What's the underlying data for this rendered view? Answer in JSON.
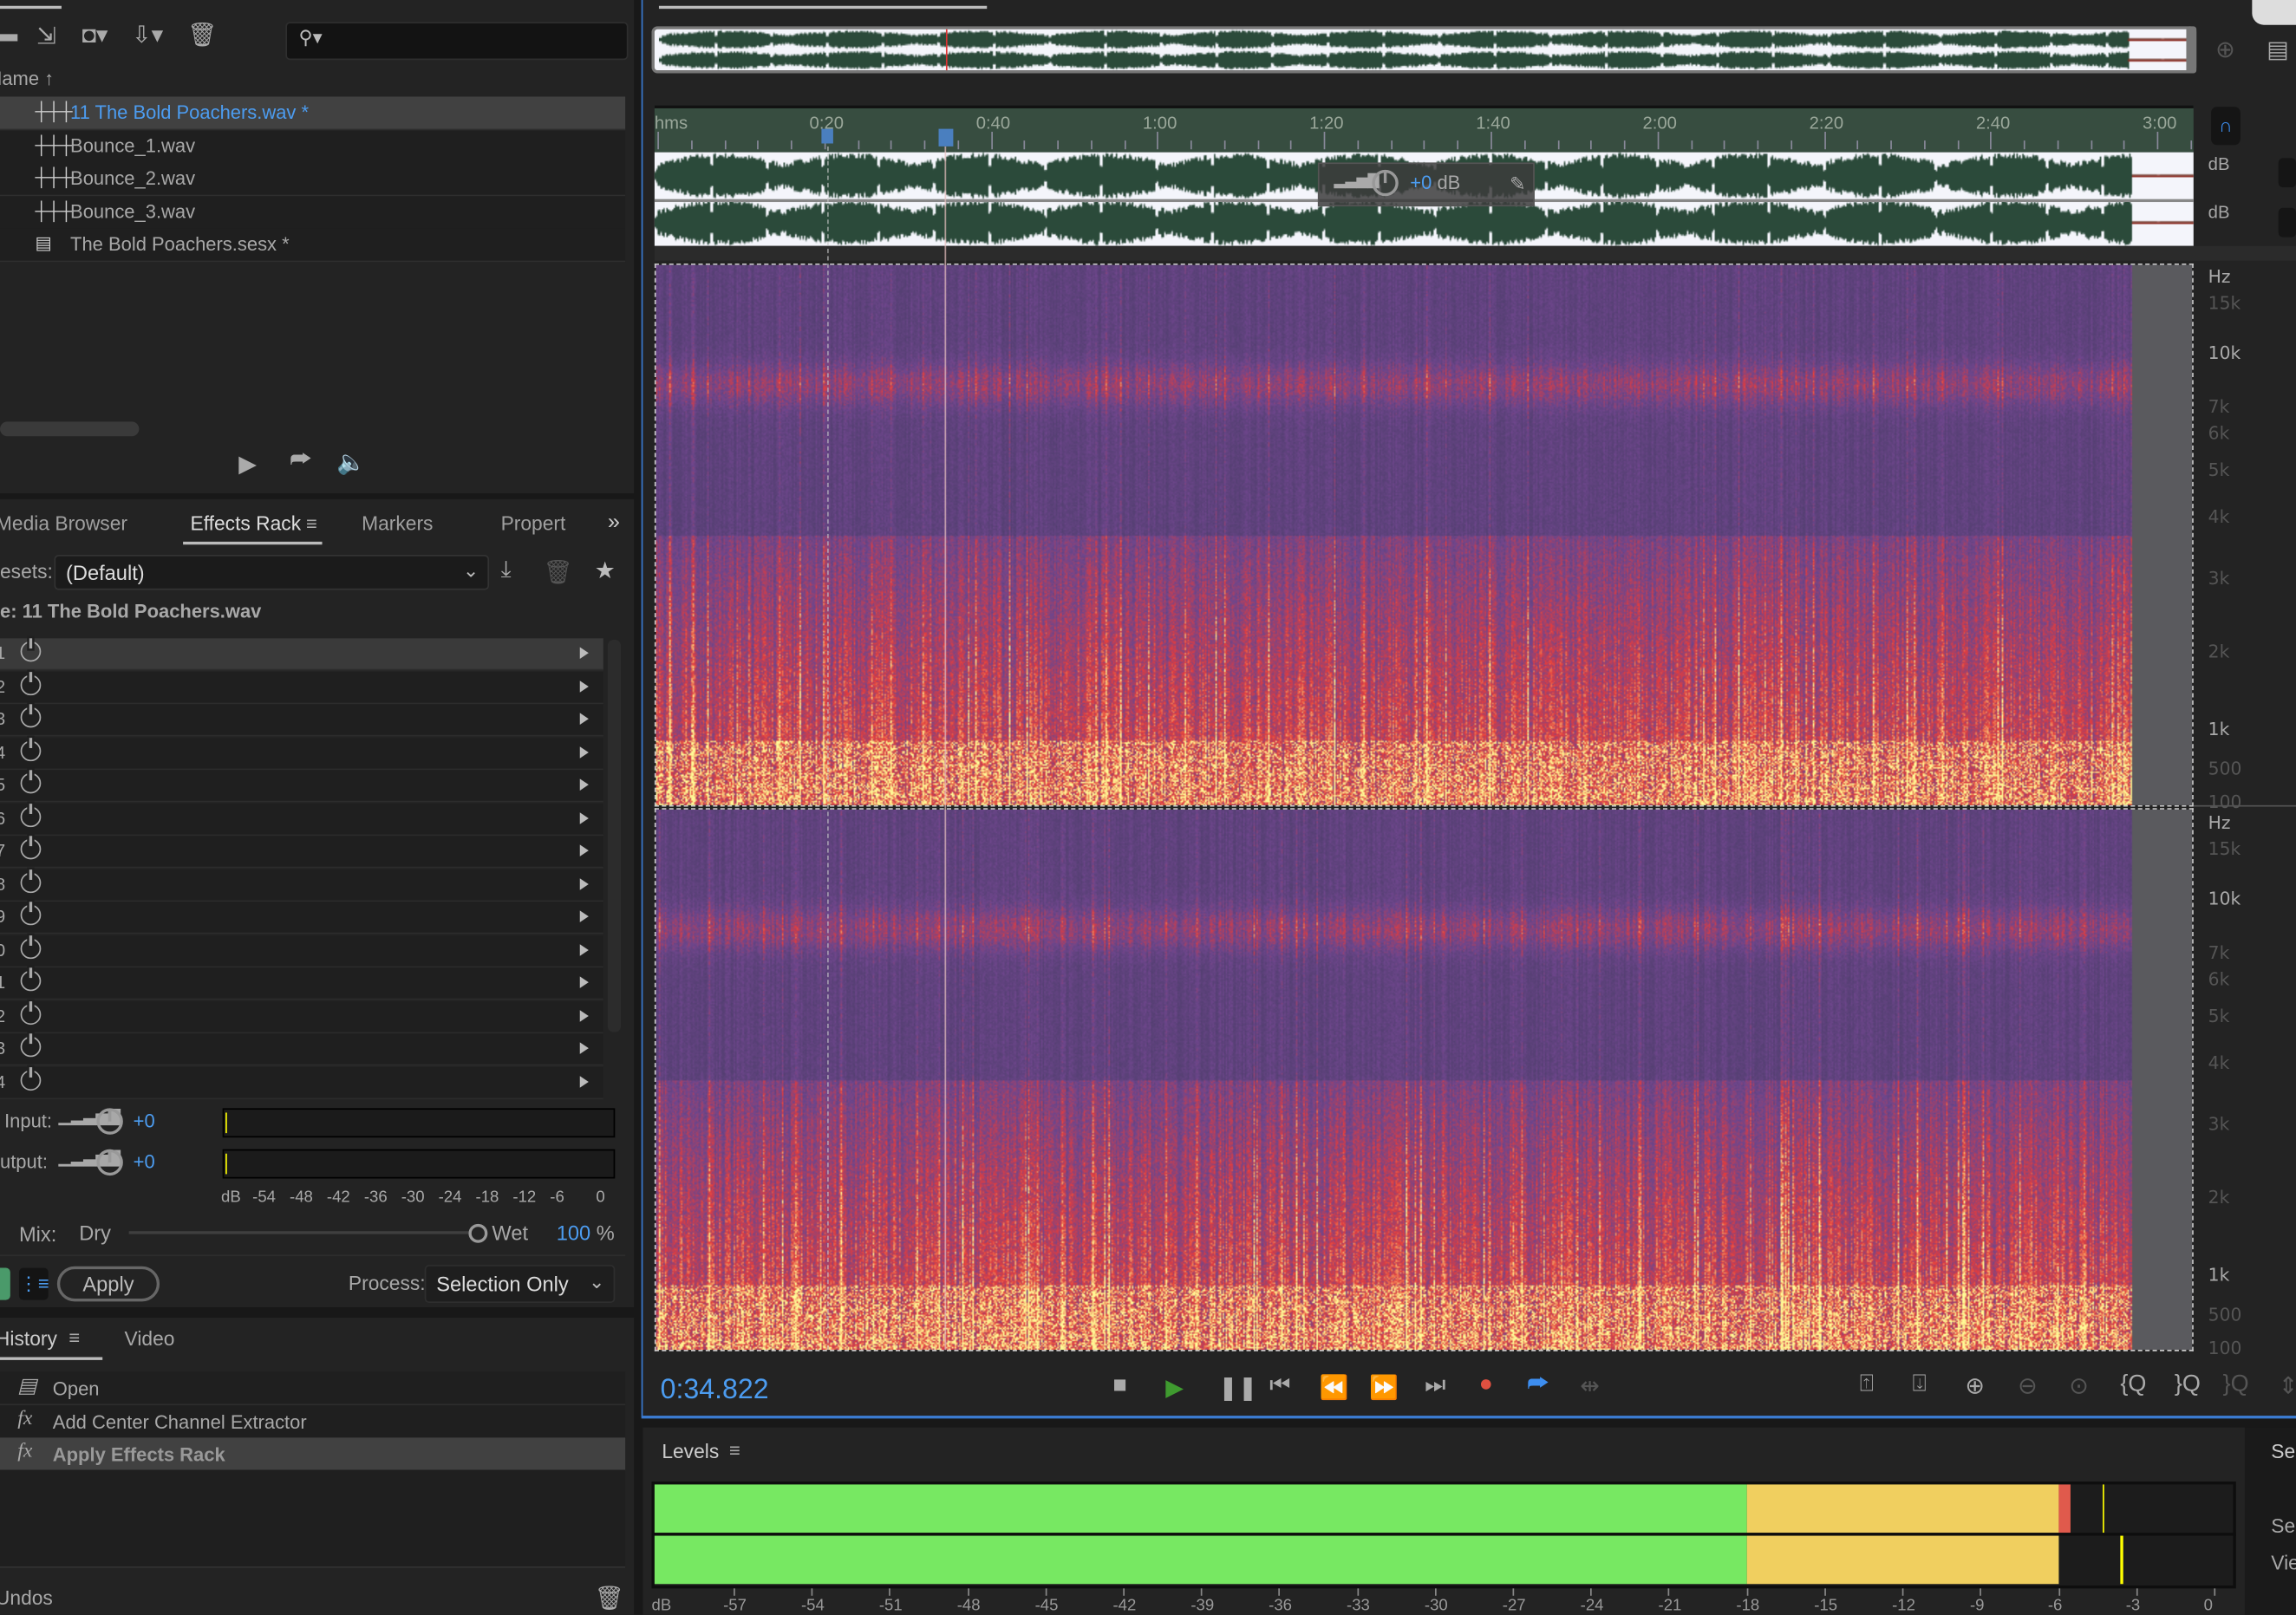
{
  "files": {
    "column_header": "Name",
    "sort_icon": "arrow-up-icon",
    "items": [
      {
        "name": "11 The Bold Poachers.wav *",
        "icon": "waveform-file-icon",
        "selected": true
      },
      {
        "name": "Bounce_1.wav",
        "icon": "waveform-file-icon"
      },
      {
        "name": "Bounce_2.wav",
        "icon": "waveform-file-icon"
      },
      {
        "name": "Bounce_3.wav",
        "icon": "waveform-file-icon"
      },
      {
        "name": "The Bold Poachers.sesx *",
        "icon": "multitrack-session-icon"
      }
    ],
    "search_placeholder": ""
  },
  "tabs": [
    {
      "label": "Media Browser"
    },
    {
      "label": "Effects Rack",
      "active": true
    },
    {
      "label": "Markers"
    },
    {
      "label": "Propert"
    }
  ],
  "effects_rack": {
    "presets_label": "esets:",
    "preset_value": "(Default)",
    "file_label": "e: 11 The Bold Poachers.wav",
    "slots": [
      "1",
      "2",
      "3",
      "4",
      "5",
      "6",
      "7",
      "8",
      "9",
      "0",
      "1",
      "2",
      "3",
      "4"
    ],
    "input_label": "Input:",
    "input_value": "+0",
    "output_label": "utput:",
    "output_value": "+0",
    "meter_scale": [
      "dB",
      "-54",
      "-48",
      "-42",
      "-36",
      "-30",
      "-24",
      "-18",
      "-12",
      "-6",
      "0"
    ],
    "mix_label": "Mix:",
    "dry_label": "Dry",
    "wet_label": "Wet",
    "mix_value": "100",
    "mix_unit": "%",
    "mix_fraction": 1.0,
    "apply_label": "Apply",
    "process_label": "Process:",
    "process_value": "Selection Only"
  },
  "history": {
    "tabs": [
      {
        "label": "History",
        "active": true
      },
      {
        "label": "Video"
      }
    ],
    "items": [
      {
        "label": "Open",
        "icon": "open-document-icon"
      },
      {
        "label": "Add Center Channel Extractor",
        "icon": "fx-icon"
      },
      {
        "label": "Apply Effects Rack",
        "icon": "fx-icon",
        "selected": true
      }
    ],
    "undos_label": "Undos"
  },
  "editor": {
    "timeline_labels": [
      "hms",
      "0:20",
      "0:40",
      "1:00",
      "1:20",
      "1:40",
      "2:00",
      "2:20",
      "2:40",
      "3:00"
    ],
    "gain_hud_value": "+0",
    "gain_hud_unit": "dB",
    "db_label": "dB",
    "hz_labels": [
      {
        "t": "Hz",
        "b": false
      },
      {
        "t": "15k",
        "b": false
      },
      {
        "t": "10k",
        "b": true
      },
      {
        "t": "7k",
        "b": false
      },
      {
        "t": "6k",
        "b": false
      },
      {
        "t": "5k",
        "b": false
      },
      {
        "t": "4k",
        "b": false
      },
      {
        "t": "3k",
        "b": false
      },
      {
        "t": "2k",
        "b": false
      },
      {
        "t": "1k",
        "b": true
      },
      {
        "t": "500",
        "b": false
      },
      {
        "t": "100",
        "b": false
      }
    ],
    "current_time": "0:34.822",
    "playhead_seconds": 34.822,
    "waveform_color": "#2b4a3a",
    "timeline_color": "#374d40",
    "accent": "#4c9cf0"
  },
  "levels": {
    "title": "Levels",
    "scale": [
      "dB",
      "-57",
      "-54",
      "-51",
      "-48",
      "-45",
      "-42",
      "-39",
      "-36",
      "-33",
      "-30",
      "-27",
      "-24",
      "-21",
      "-18",
      "-15",
      "-12",
      "-9",
      "-6",
      "-3",
      "0"
    ],
    "left_level_db": -5.5,
    "right_level_db": -6.0,
    "left_peak_db": -4.3,
    "right_peak_db": -3.6,
    "colors": {
      "green": "#77e862",
      "yellow": "#f0cf5f",
      "red": "#e05a4c"
    }
  },
  "side_panel": {
    "labels": [
      "Sel",
      "Sel",
      "Vie"
    ]
  }
}
